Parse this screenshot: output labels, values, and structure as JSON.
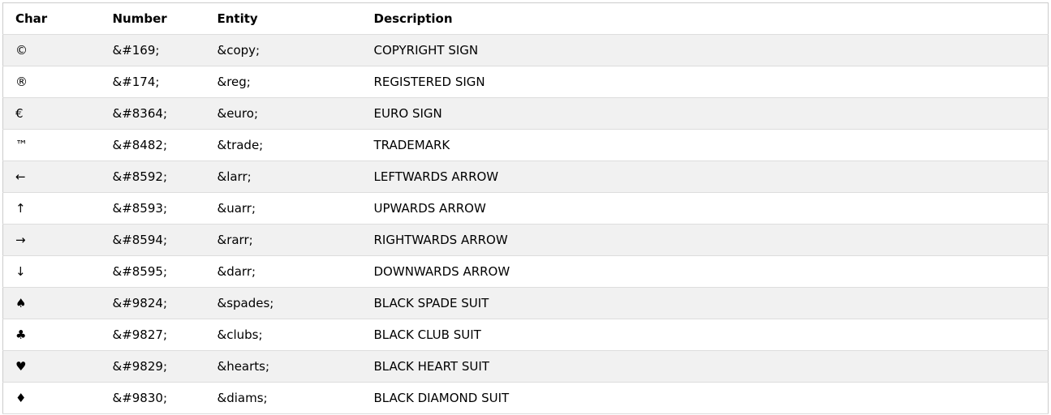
{
  "table": {
    "headers": {
      "char": "Char",
      "number": "Number",
      "entity": "Entity",
      "description": "Description"
    },
    "rows": [
      {
        "char": "©",
        "number": "&#169;",
        "entity": "&copy;",
        "description": "COPYRIGHT SIGN"
      },
      {
        "char": "®",
        "number": "&#174;",
        "entity": "&reg;",
        "description": "REGISTERED SIGN"
      },
      {
        "char": "€",
        "number": "&#8364;",
        "entity": "&euro;",
        "description": "EURO SIGN"
      },
      {
        "char": "™",
        "number": "&#8482;",
        "entity": "&trade;",
        "description": "TRADEMARK"
      },
      {
        "char": "←",
        "number": "&#8592;",
        "entity": "&larr;",
        "description": "LEFTWARDS ARROW"
      },
      {
        "char": "↑",
        "number": "&#8593;",
        "entity": "&uarr;",
        "description": "UPWARDS ARROW"
      },
      {
        "char": "→",
        "number": "&#8594;",
        "entity": "&rarr;",
        "description": "RIGHTWARDS ARROW"
      },
      {
        "char": "↓",
        "number": "&#8595;",
        "entity": "&darr;",
        "description": "DOWNWARDS ARROW"
      },
      {
        "char": "♠",
        "number": "&#9824;",
        "entity": "&spades;",
        "description": "BLACK SPADE SUIT"
      },
      {
        "char": "♣",
        "number": "&#9827;",
        "entity": "&clubs;",
        "description": "BLACK CLUB SUIT"
      },
      {
        "char": "♥",
        "number": "&#9829;",
        "entity": "&hearts;",
        "description": "BLACK HEART SUIT"
      },
      {
        "char": "♦",
        "number": "&#9830;",
        "entity": "&diams;",
        "description": "BLACK DIAMOND SUIT"
      }
    ]
  }
}
